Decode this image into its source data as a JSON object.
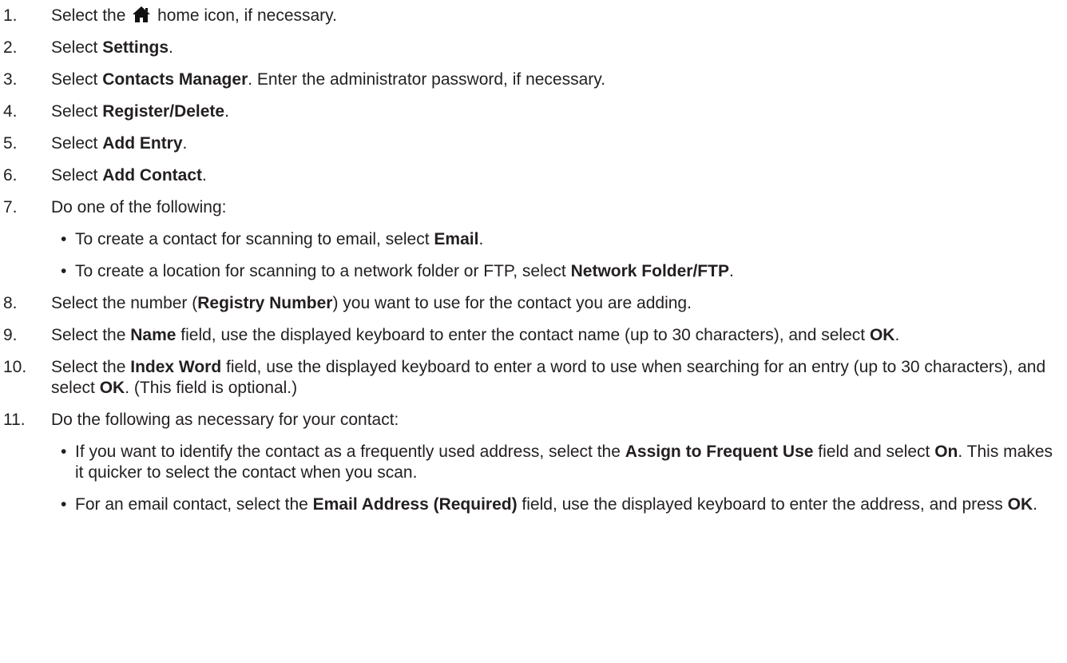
{
  "steps": [
    {
      "num": "1.",
      "parts": [
        {
          "t": "Select the "
        },
        {
          "icon": "home-icon"
        },
        {
          "t": " home icon, if necessary."
        }
      ]
    },
    {
      "num": "2.",
      "parts": [
        {
          "t": "Select "
        },
        {
          "b": "Settings"
        },
        {
          "t": "."
        }
      ]
    },
    {
      "num": "3.",
      "parts": [
        {
          "t": "Select "
        },
        {
          "b": "Contacts Manager"
        },
        {
          "t": ". Enter the administrator password, if necessary."
        }
      ]
    },
    {
      "num": "4.",
      "parts": [
        {
          "t": "Select "
        },
        {
          "b": "Register/Delete"
        },
        {
          "t": "."
        }
      ]
    },
    {
      "num": "5.",
      "parts": [
        {
          "t": "Select "
        },
        {
          "b": "Add Entry"
        },
        {
          "t": "."
        }
      ]
    },
    {
      "num": "6.",
      "parts": [
        {
          "t": "Select "
        },
        {
          "b": "Add Contact"
        },
        {
          "t": "."
        }
      ]
    },
    {
      "num": "7.",
      "parts": [
        {
          "t": "Do one of the following:"
        }
      ],
      "bullets": [
        [
          {
            "t": "To create a contact for scanning to email, select "
          },
          {
            "b": "Email"
          },
          {
            "t": "."
          }
        ],
        [
          {
            "t": "To create a location for scanning to a network folder or FTP, select "
          },
          {
            "b": "Network Folder/FTP"
          },
          {
            "t": "."
          }
        ]
      ]
    },
    {
      "num": "8.",
      "parts": [
        {
          "t": "Select the number ("
        },
        {
          "b": "Registry Number"
        },
        {
          "t": ") you want to use for the contact you are adding."
        }
      ]
    },
    {
      "num": "9.",
      "parts": [
        {
          "t": "Select the "
        },
        {
          "b": "Name"
        },
        {
          "t": " field, use the displayed keyboard to enter the contact name (up to 30 characters), and select "
        },
        {
          "b": "OK"
        },
        {
          "t": "."
        }
      ]
    },
    {
      "num": "10.",
      "parts": [
        {
          "t": "Select the "
        },
        {
          "b": "Index Word"
        },
        {
          "t": " field, use the displayed keyboard to enter a word to use when searching for an entry (up to 30 characters), and select "
        },
        {
          "b": "OK"
        },
        {
          "t": ". (This field is optional.)"
        }
      ]
    },
    {
      "num": "11.",
      "parts": [
        {
          "t": "Do the following as necessary for your contact:"
        }
      ],
      "bullets": [
        [
          {
            "t": "If you want to identify the contact as a frequently used address, select the "
          },
          {
            "b": "Assign to Frequent Use"
          },
          {
            "t": " field and select "
          },
          {
            "b": "On"
          },
          {
            "t": ". This makes it quicker to select the contact when you scan."
          }
        ],
        [
          {
            "t": "For an email contact, select the "
          },
          {
            "b": "Email Address (Required)"
          },
          {
            "t": " field, use the displayed keyboard to enter the address, and press "
          },
          {
            "b": "OK"
          },
          {
            "t": "."
          }
        ]
      ]
    }
  ],
  "bullet_glyph": "•",
  "colors": {
    "text": "#231f20",
    "background": "#ffffff"
  }
}
